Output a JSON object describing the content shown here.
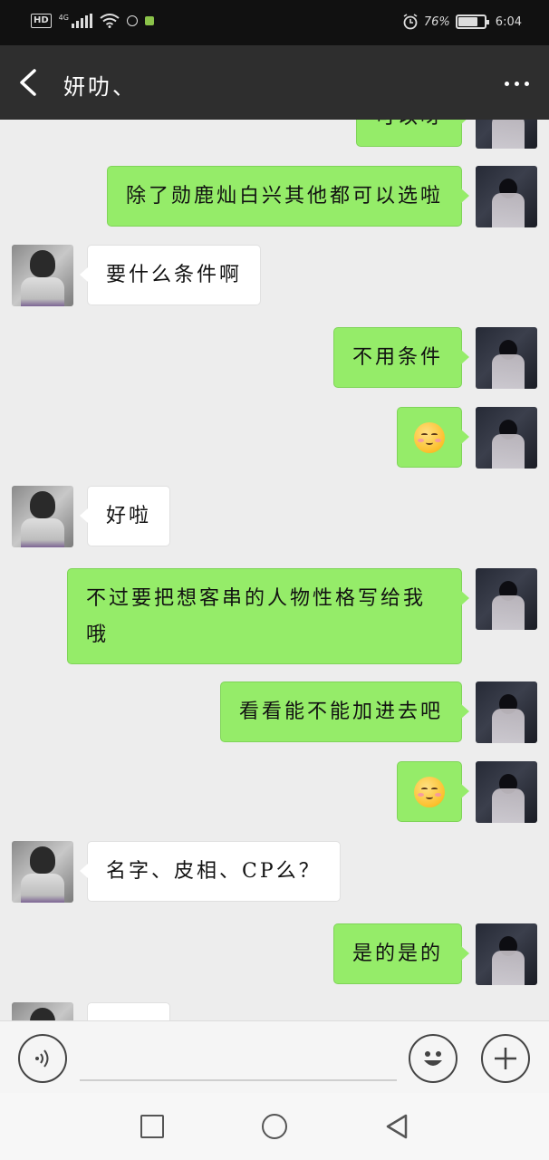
{
  "status_bar": {
    "hd": "HD",
    "network": "4G",
    "battery_text": "76%",
    "battery_level": 0.76,
    "time": "6:04"
  },
  "header": {
    "title": "妍叻、",
    "back_icon": "chevron-left-icon",
    "more_icon": "more-horizontal-icon"
  },
  "messages": [
    {
      "from": "me",
      "type": "text",
      "text": "可以呀"
    },
    {
      "from": "me",
      "type": "text",
      "text": "除了勋鹿灿白兴其他都可以选啦"
    },
    {
      "from": "other",
      "type": "text",
      "text": "要什么条件啊"
    },
    {
      "from": "me",
      "type": "text",
      "text": "不用条件"
    },
    {
      "from": "me",
      "type": "emoji",
      "text": "",
      "emoji": "blushing-face-icon"
    },
    {
      "from": "other",
      "type": "text",
      "text": "好啦"
    },
    {
      "from": "me",
      "type": "text",
      "text": "不过要把想客串的人物性格写给我哦"
    },
    {
      "from": "me",
      "type": "text",
      "text": "看看能不能加进去吧"
    },
    {
      "from": "me",
      "type": "emoji",
      "text": "",
      "emoji": "blushing-face-icon"
    },
    {
      "from": "other",
      "type": "text",
      "text": "名字、皮相、CP么？"
    },
    {
      "from": "me",
      "type": "text",
      "text": "是的是的"
    },
    {
      "from": "other",
      "type": "text",
      "text": ""
    }
  ],
  "input_bar": {
    "voice_icon": "voice-icon",
    "emoji_icon": "smiley-icon",
    "plus_icon": "plus-icon",
    "placeholder": ""
  },
  "system_nav": {
    "recent_icon": "square-icon",
    "home_icon": "circle-icon",
    "back_icon": "triangle-back-icon"
  },
  "colors": {
    "my_bubble": "#95ec69",
    "other_bubble": "#ffffff",
    "header_bg": "#2e2e2e",
    "chat_bg": "#ededed"
  }
}
